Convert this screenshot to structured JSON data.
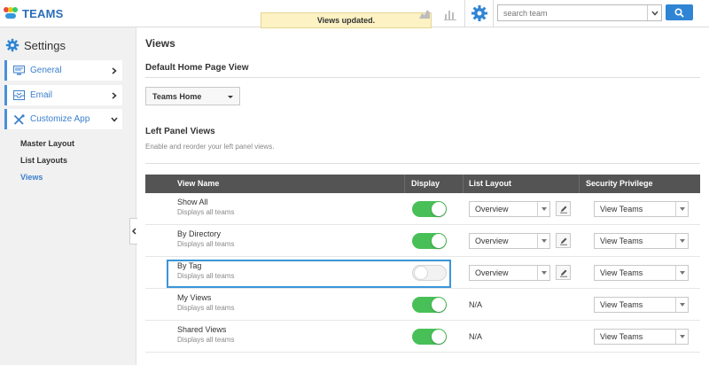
{
  "app": {
    "title": "TEAMS",
    "toast": "Views updated.",
    "search": {
      "placeholder": "search team"
    }
  },
  "sidebar": {
    "heading": "Settings",
    "items": [
      {
        "label": "General",
        "icon": "monitor-icon",
        "chevron": "chevron-right"
      },
      {
        "label": "Email",
        "icon": "inbox-icon",
        "chevron": "chevron-right"
      },
      {
        "label": "Customize App",
        "icon": "tools-icon",
        "chevron": "chevron-down"
      }
    ],
    "subitems": [
      {
        "label": "Master Layout",
        "active": false
      },
      {
        "label": "List Layouts",
        "active": false
      },
      {
        "label": "Views",
        "active": true
      }
    ]
  },
  "main": {
    "title": "Views",
    "default_home_heading": "Default Home Page View",
    "default_home_value": "Teams Home",
    "left_panel_heading": "Left Panel Views",
    "left_panel_sub": "Enable and reorder your left panel views."
  },
  "table": {
    "headers": [
      "View Name",
      "Display",
      "List Layout",
      "Security Privilege"
    ],
    "rows": [
      {
        "name": "Show All",
        "desc": "Displays all teams",
        "display": true,
        "layout": "Overview",
        "security": "View Teams"
      },
      {
        "name": "By Directory",
        "desc": "Displays all teams",
        "display": true,
        "layout": "Overview",
        "security": "View Teams"
      },
      {
        "name": "By Tag",
        "desc": "Displays all teams",
        "display": false,
        "layout": "Overview",
        "security": "View Teams"
      },
      {
        "name": "My Views",
        "desc": "Displays all teams",
        "display": true,
        "layout": "N/A",
        "security": "View Teams"
      },
      {
        "name": "Shared Views",
        "desc": "Displays all teams",
        "display": true,
        "layout": "N/A",
        "security": "View Teams"
      }
    ]
  },
  "colors": {
    "accent": "#2f85d4",
    "toggle_on": "#48c057",
    "header_bg": "#545454",
    "toast_bg": "#fdf2c4"
  }
}
